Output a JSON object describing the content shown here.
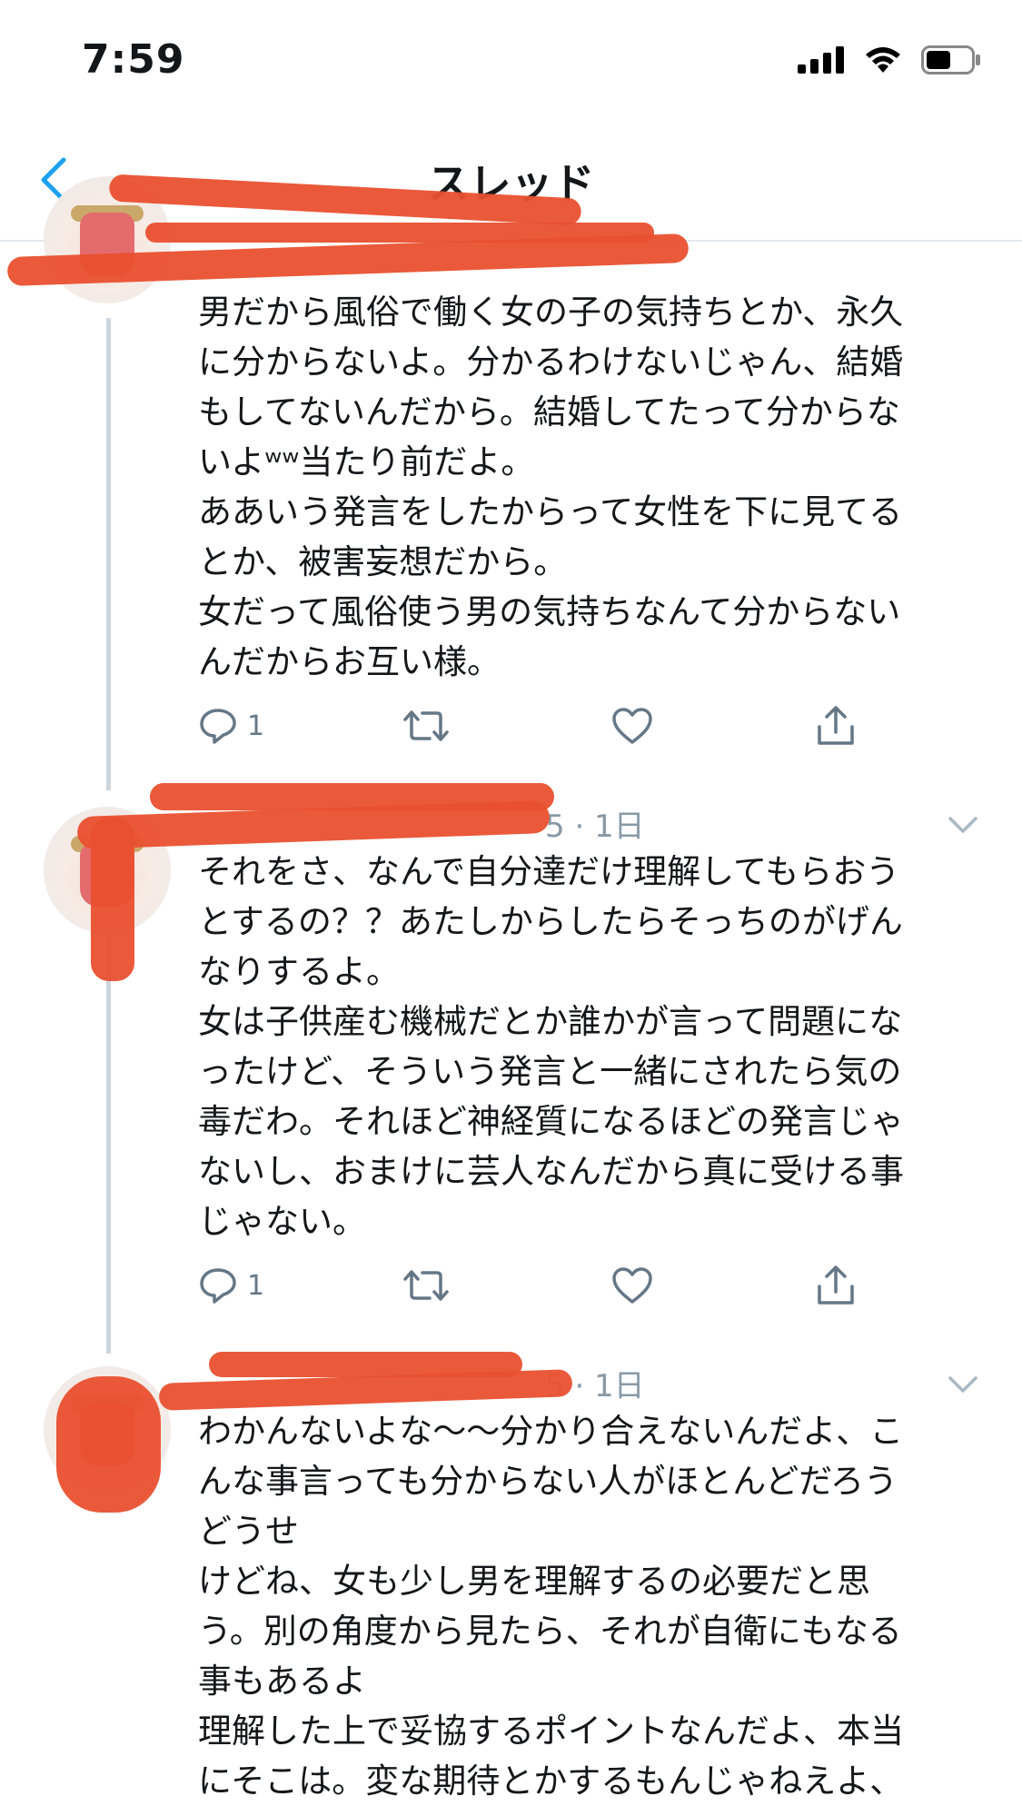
{
  "status_bar": {
    "time": "7:59",
    "icons": [
      "cellular-signal-icon",
      "wifi-icon",
      "battery-icon"
    ]
  },
  "nav": {
    "title": "スレッド",
    "back_icon": "back-arrow-icon"
  },
  "colors": {
    "accent": "#1da1f2",
    "redaction": "#e9502f",
    "secondary_text": "#657786",
    "divider": "#e1e8ed"
  },
  "tweets": [
    {
      "author_tail": "",
      "text": "男だから風俗で働く女の子の気持ちとか、永久\nに分からないよ。分かるわけないじゃん、結婚\nもしてないんだから。結婚してたって分からな\nいよʷʷ当たり前だよ。\nああいう発言をしたからって女性を下に見てる\nとか、被害妄想だから。\n女だって風俗使う男の気持ちなんて分からない\nんだからお互い様。",
      "reply_count": "1"
    },
    {
      "author_tail": "5 · 1日",
      "text": "それをさ、なんで自分達だけ理解してもらおう\nとするの？？あたしからしたらそっちのがげん\nなりするよ。\n女は子供産む機械だとか誰かが言って問題にな\nったけど、そういう発言と一緒にされたら気の\n毒だわ。それほど神経質になるほどの発言じゃ\nないし、おまけに芸人なんだから真に受ける事\nじゃない。",
      "reply_count": "1"
    },
    {
      "author_tail": "5 · 1日",
      "text": "わかんないよな〜〜分かり合えないんだよ、こ\nんな事言っても分からない人がほとんどだろう\nどうせ\nけどね、女も少し男を理解するの必要だと思\nう。別の角度から見たら、それが自衛にもなる\n事もあるよ\n理解した上で妥協するポイントなんだよ、本当\nにそこは。変な期待とかするもんじゃねえよ、"
    }
  ]
}
